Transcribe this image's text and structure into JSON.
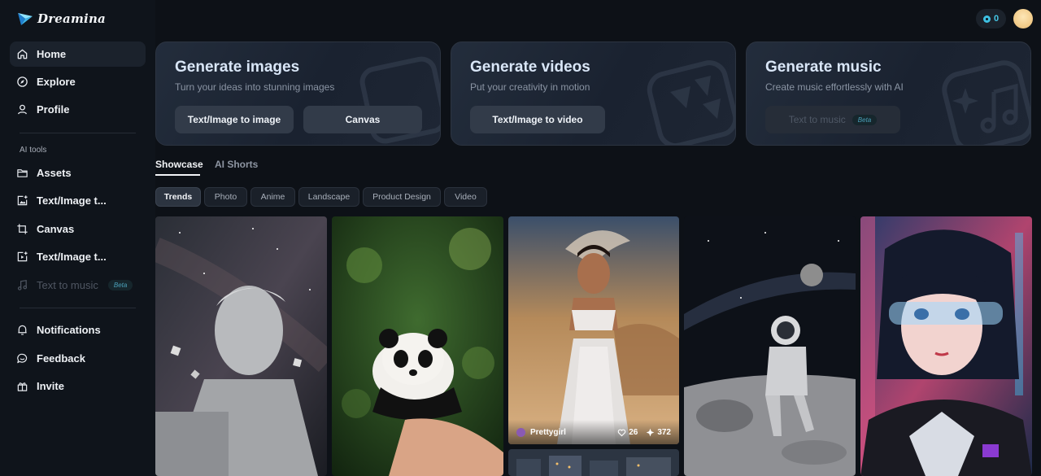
{
  "app": {
    "name": "Dreamina"
  },
  "sidebar": {
    "main": [
      {
        "label": "Home",
        "icon": "home-icon",
        "active": true
      },
      {
        "label": "Explore",
        "icon": "compass-icon"
      },
      {
        "label": "Profile",
        "icon": "user-icon"
      }
    ],
    "section_label": "AI tools",
    "tools": [
      {
        "label": "Assets",
        "icon": "folder-icon"
      },
      {
        "label": "Text/Image t...",
        "icon": "image-edit-icon"
      },
      {
        "label": "Canvas",
        "icon": "crop-icon"
      },
      {
        "label": "Text/Image t...",
        "icon": "video-edit-icon"
      },
      {
        "label": "Text to music",
        "icon": "music-note-icon",
        "badge": "Beta",
        "disabled": true
      }
    ],
    "bottom": [
      {
        "label": "Notifications",
        "icon": "bell-icon"
      },
      {
        "label": "Feedback",
        "icon": "chat-bubble-icon"
      },
      {
        "label": "Invite",
        "icon": "gift-icon"
      }
    ]
  },
  "header": {
    "credits": "0"
  },
  "cards": [
    {
      "title": "Generate images",
      "subtitle": "Turn your ideas into stunning images",
      "buttons": [
        {
          "label": "Text/Image to image"
        },
        {
          "label": "Canvas"
        }
      ]
    },
    {
      "title": "Generate videos",
      "subtitle": "Put your creativity in motion",
      "buttons": [
        {
          "label": "Text/Image to video"
        }
      ]
    },
    {
      "title": "Generate music",
      "subtitle": "Create music effortlessly with AI",
      "buttons": [
        {
          "label": "Text to music",
          "badge": "Beta",
          "disabled": true
        }
      ]
    }
  ],
  "tabs": [
    {
      "label": "Showcase",
      "active": true
    },
    {
      "label": "AI Shorts"
    }
  ],
  "filters": [
    {
      "label": "Trends",
      "active": true
    },
    {
      "label": "Photo"
    },
    {
      "label": "Anime"
    },
    {
      "label": "Landscape"
    },
    {
      "label": "Product Design"
    },
    {
      "label": "Video"
    }
  ],
  "gallery": [
    {
      "subject": "marble statue bust in space"
    },
    {
      "subject": "baby panda on fingertip"
    },
    {
      "subject": "woman in sparkling gown in desert",
      "author": "Prettygirl",
      "likes": "26",
      "remixes": "372"
    },
    {
      "subject": "astronaut on the moon"
    },
    {
      "subject": "anime girl with visor"
    }
  ]
}
